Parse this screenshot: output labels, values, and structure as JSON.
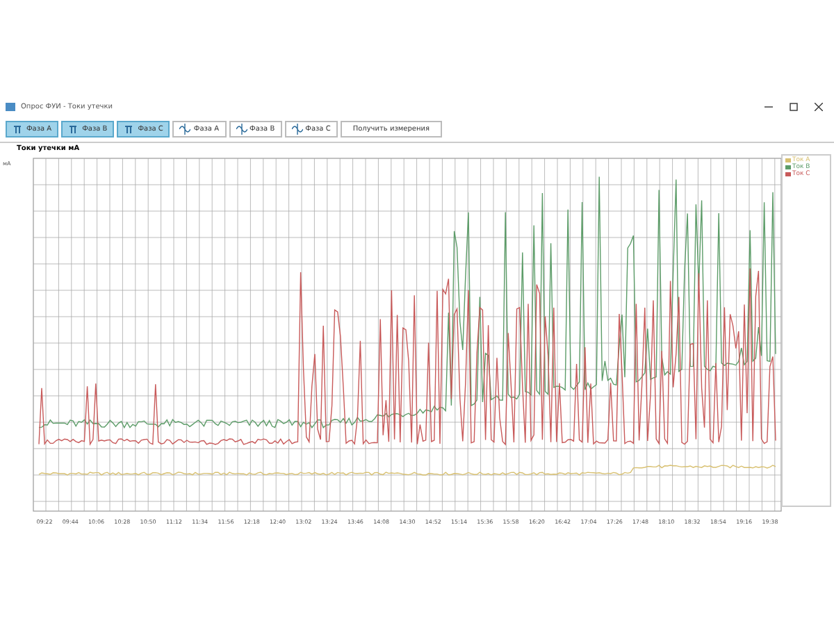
{
  "window": {
    "title": "Опрос ФУИ - Токи утечки"
  },
  "toolbar": [
    {
      "kind": "phase",
      "label": "Фаза A",
      "selected": true
    },
    {
      "kind": "phase",
      "label": "Фаза B",
      "selected": true
    },
    {
      "kind": "phase",
      "label": "Фаза C",
      "selected": true
    },
    {
      "kind": "wave",
      "label": "Фаза A",
      "selected": false
    },
    {
      "kind": "wave",
      "label": "Фаза B",
      "selected": false
    },
    {
      "kind": "wave",
      "label": "Фаза C",
      "selected": false
    },
    {
      "kind": "action",
      "label": "Получить измерения",
      "selected": false
    }
  ],
  "chart": {
    "title": "Токи утечки мА",
    "unit": "мА",
    "legend": [
      {
        "label": "Ток A",
        "color": "#d8c070"
      },
      {
        "label": "Ток B",
        "color": "#5c9c68"
      },
      {
        "label": "Ток C",
        "color": "#c85a5a"
      }
    ],
    "x_labels": [
      "09:22",
      "09:44",
      "10:06",
      "10:28",
      "10:50",
      "11:12",
      "11:34",
      "11:56",
      "12:18",
      "12:40",
      "13:02",
      "13:24",
      "13:46",
      "14:08",
      "14:30",
      "14:52",
      "15:14",
      "15:36",
      "15:58",
      "16:20",
      "16:42",
      "17:04",
      "17:26",
      "17:48",
      "18:10",
      "18:32",
      "18:54",
      "19:16",
      "19:38"
    ]
  }
}
